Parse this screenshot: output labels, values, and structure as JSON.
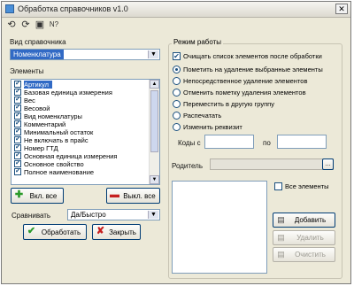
{
  "window": {
    "title": "Обработка справочников v1.0",
    "close_glyph": "✕"
  },
  "toolbar": {
    "icons": [
      "refresh-icon",
      "refresh-all-icon",
      "save-icon",
      "help-icon"
    ],
    "glyphs": [
      "⟲",
      "⟳",
      "▣",
      "N?"
    ]
  },
  "left": {
    "catalog_type_label": "Вид справочника",
    "catalog_type_value": "Номенклатура",
    "elements_label": "Элементы",
    "elements": [
      {
        "label": "Артикул",
        "checked": true,
        "selected": true
      },
      {
        "label": "Базовая единица измерения",
        "checked": true,
        "selected": false
      },
      {
        "label": "Вес",
        "checked": true,
        "selected": false
      },
      {
        "label": "Весовой",
        "checked": true,
        "selected": false
      },
      {
        "label": "Вид номенклатуры",
        "checked": true,
        "selected": false
      },
      {
        "label": "Комментарий",
        "checked": true,
        "selected": false
      },
      {
        "label": "Минимальный остаток",
        "checked": true,
        "selected": false
      },
      {
        "label": "Не включать в прайс",
        "checked": true,
        "selected": false
      },
      {
        "label": "Номер ГТД",
        "checked": true,
        "selected": false
      },
      {
        "label": "Основная единица измерения",
        "checked": true,
        "selected": false
      },
      {
        "label": "Основное свойство",
        "checked": true,
        "selected": false
      },
      {
        "label": "Полное наименование",
        "checked": true,
        "selected": false
      }
    ],
    "enable_all_label": "Вкл. все",
    "disable_all_label": "Выкл. все",
    "compare_label": "Сравнивать",
    "compare_value": "Да/Быстро",
    "process_label": "Обработать",
    "close_label": "Закрыть"
  },
  "right": {
    "mode_group_title": "Режим работы",
    "clear_list_label": "Очищать список элементов после обработки",
    "clear_list_checked": true,
    "modes": [
      {
        "label": "Пометить на удаление выбранные элементы",
        "selected": true
      },
      {
        "label": "Непосредственное удаление элементов",
        "selected": false
      },
      {
        "label": "Отменить пометку удаления элементов",
        "selected": false
      },
      {
        "label": "Переместить в другую группу",
        "selected": false
      },
      {
        "label": "Распечатать",
        "selected": false
      },
      {
        "label": "Изменить реквизит",
        "selected": false
      }
    ],
    "code_from_label": "Коды с",
    "code_from_value": "",
    "code_to_label": "по",
    "code_to_value": "",
    "parent_label": "Родитель",
    "parent_value": "",
    "all_elements_label": "Все элементы",
    "all_elements_checked": false,
    "add_label": "Добавить",
    "delete_label": "Удалить",
    "clear_label": "Очистить"
  }
}
